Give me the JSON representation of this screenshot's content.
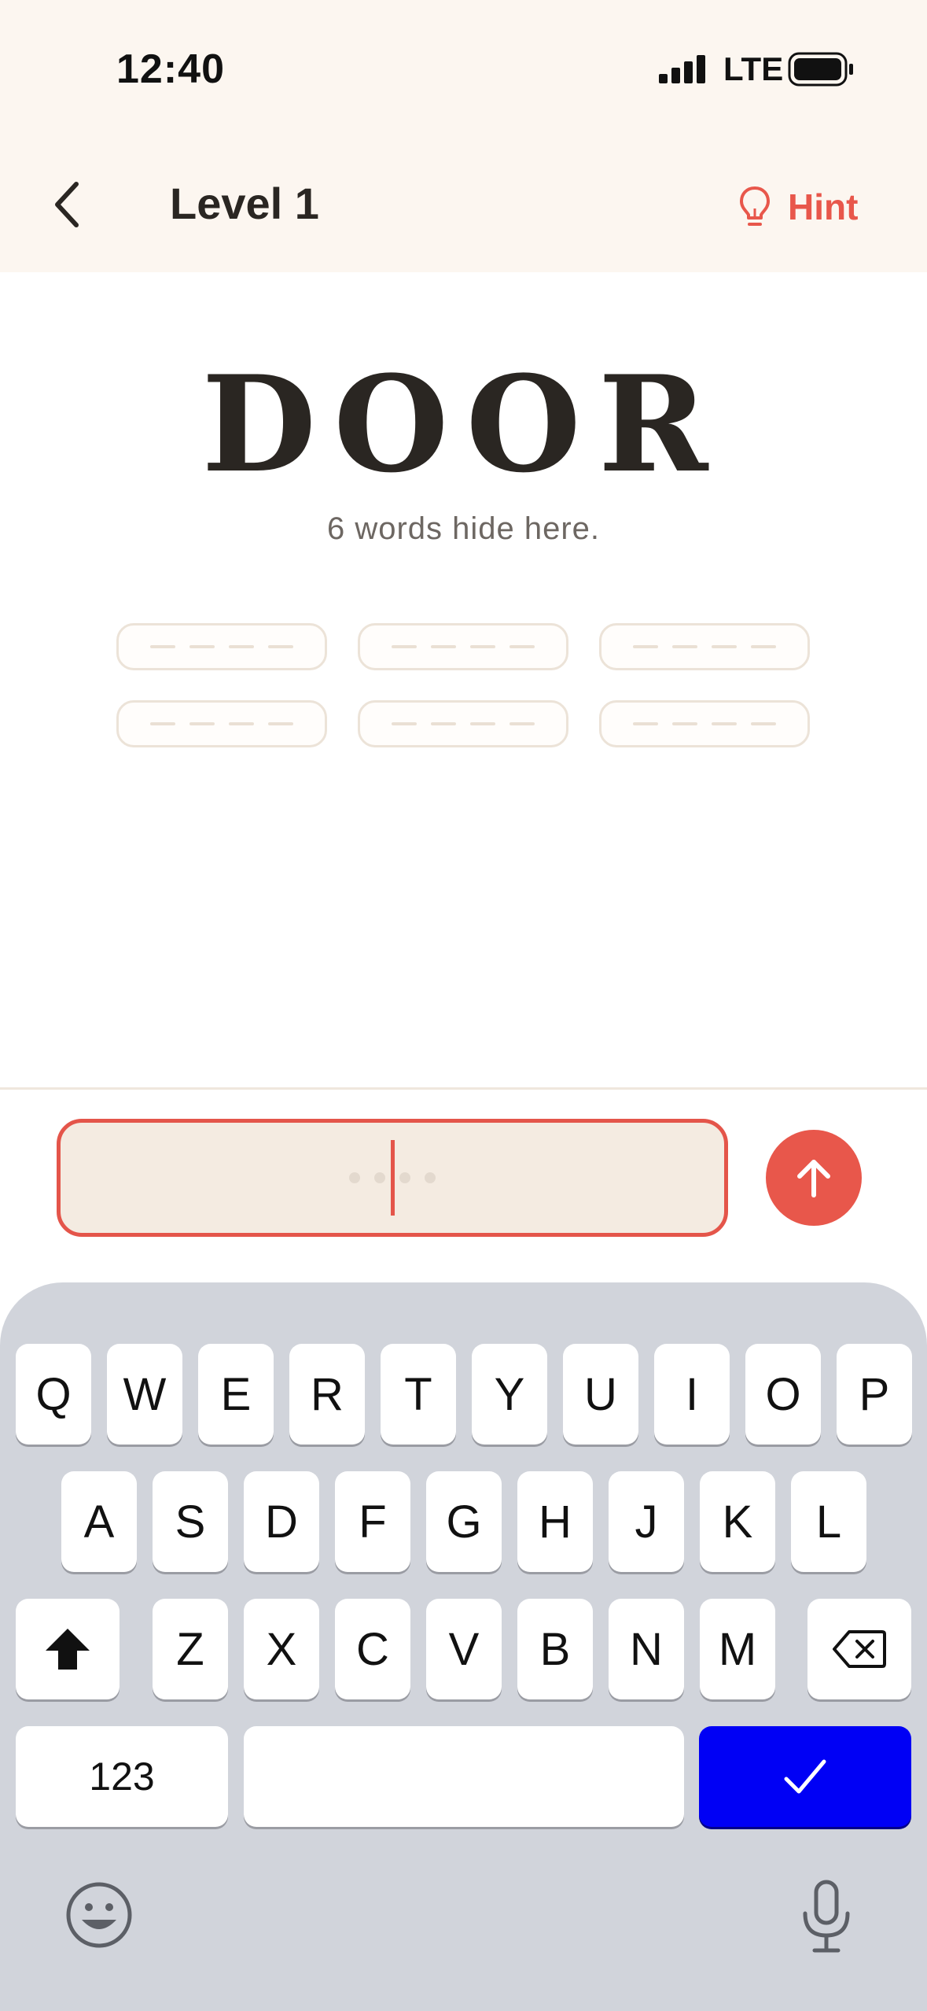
{
  "status_bar": {
    "time": "12:40",
    "network": "LTE",
    "icons": [
      "signal-bars-icon",
      "battery-icon"
    ]
  },
  "header": {
    "back_icon": "chevron-left-icon",
    "title": "Level 1",
    "hint_label": "Hint",
    "hint_icon": "lightbulb-icon"
  },
  "puzzle": {
    "word": "DOOR",
    "subtitle": "6 words hide here.",
    "slot_count": 6,
    "letters_per_slot": 4
  },
  "input": {
    "placeholder_dot_count": 4,
    "submit_icon": "arrow-up-icon"
  },
  "keyboard": {
    "row1": [
      "Q",
      "W",
      "E",
      "R",
      "T",
      "Y",
      "U",
      "I",
      "O",
      "P"
    ],
    "row2": [
      "A",
      "S",
      "D",
      "F",
      "G",
      "H",
      "J",
      "K",
      "L"
    ],
    "row3": [
      "Z",
      "X",
      "C",
      "V",
      "B",
      "N",
      "M"
    ],
    "numbers_label": "123",
    "shift_icon": "shift-icon",
    "delete_icon": "backspace-icon",
    "done_icon": "checkmark-icon",
    "emoji_icon": "emoji-icon",
    "mic_icon": "microphone-icon"
  },
  "colors": {
    "accent": "#e8574b",
    "header_bg": "#fcf6f0",
    "input_bg": "#f4ebe1",
    "keyboard_bg": "#d1d4db",
    "done_key": "#0000f5"
  }
}
